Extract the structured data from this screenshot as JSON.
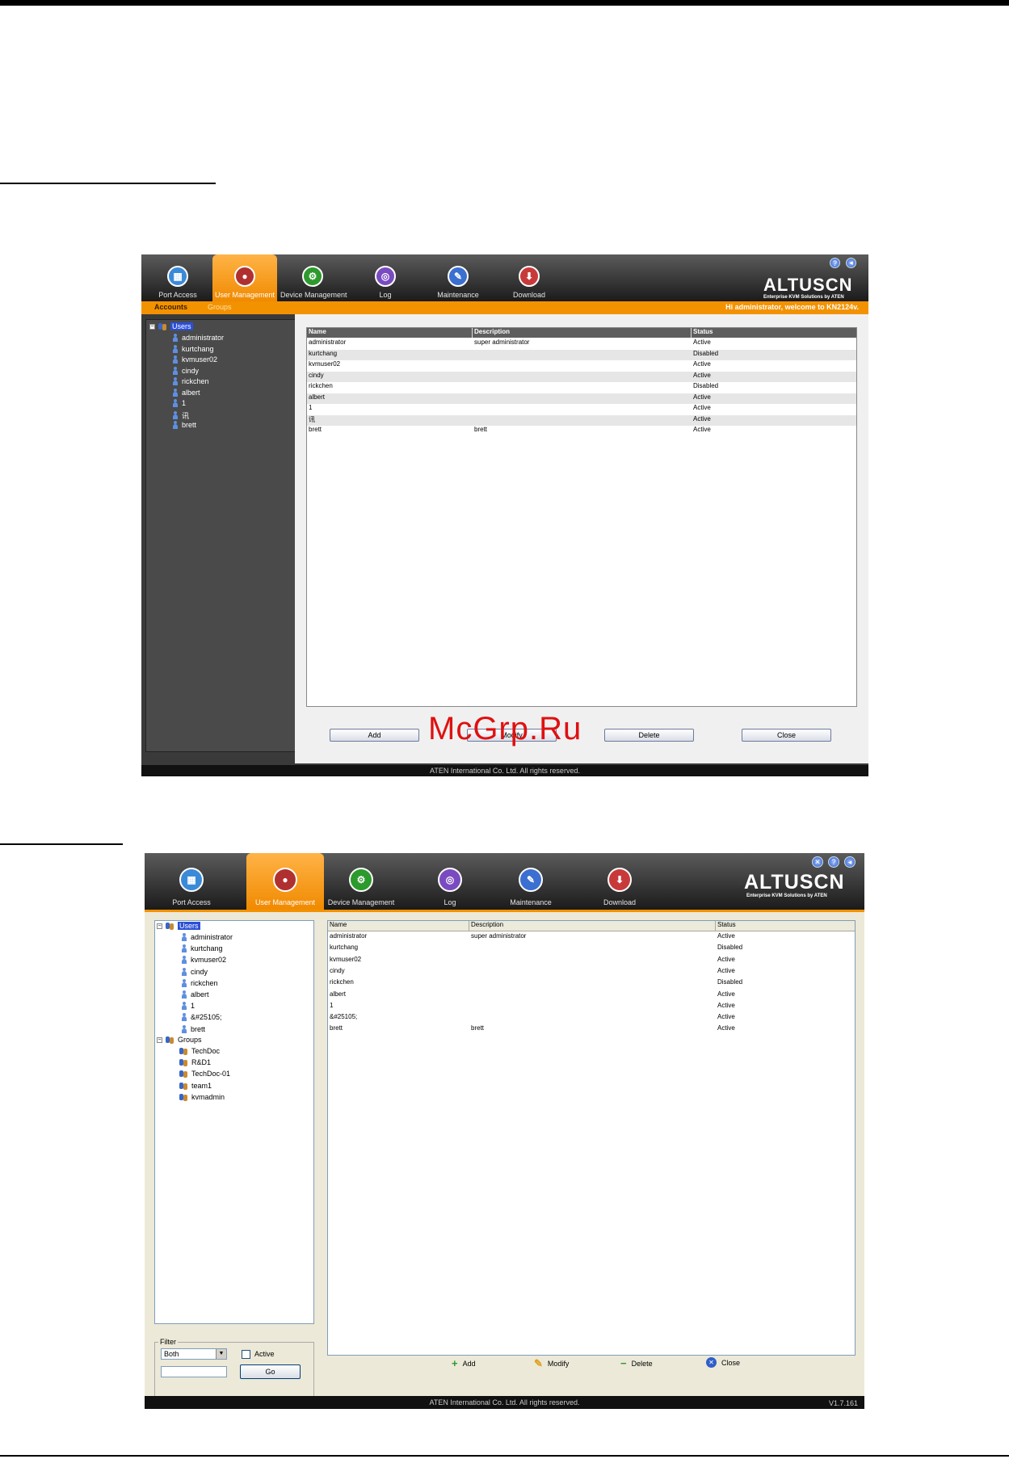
{
  "window_a": {
    "tabs": [
      {
        "label": "Port Access",
        "glyph": "▦"
      },
      {
        "label": "User Management",
        "glyph": "●"
      },
      {
        "label": "Device Management",
        "glyph": "⚙"
      },
      {
        "label": "Log",
        "glyph": "◎"
      },
      {
        "label": "Maintenance",
        "glyph": "✎"
      },
      {
        "label": "Download",
        "glyph": "⬇"
      }
    ],
    "logo": "ALTUSCN",
    "tagline": "Enterprise KVM Solutions by ATEN",
    "subtabs": [
      "Accounts",
      "Groups"
    ],
    "welcome": "Hi administrator, welcome to KN2124v.",
    "tree_root": "Users",
    "users": [
      "administrator",
      "kurtchang",
      "kvmuser02",
      "cindy",
      "rickchen",
      "albert",
      "1",
      "讯",
      "brett"
    ],
    "columns": [
      "Name",
      "Description",
      "Status"
    ],
    "rows": [
      [
        "administrator",
        "super administrator",
        "Active"
      ],
      [
        "kurtchang",
        "",
        "Disabled"
      ],
      [
        "kvmuser02",
        "",
        "Active"
      ],
      [
        "cindy",
        "",
        "Active"
      ],
      [
        "rickchen",
        "",
        "Disabled"
      ],
      [
        "albert",
        "",
        "Active"
      ],
      [
        "1",
        "",
        "Active"
      ],
      [
        "讯",
        "",
        "Active"
      ],
      [
        "brett",
        "brett",
        "Active"
      ]
    ],
    "buttons": {
      "add": "Add",
      "modify": "Modify",
      "delete": "Delete",
      "close": "Close"
    },
    "footer": "ATEN International Co. Ltd. All rights reserved."
  },
  "window_b": {
    "tabs": [
      {
        "label": "Port Access",
        "glyph": "▦"
      },
      {
        "label": "User Management",
        "glyph": "●"
      },
      {
        "label": "Device Management",
        "glyph": "⚙"
      },
      {
        "label": "Log",
        "glyph": "◎"
      },
      {
        "label": "Maintenance",
        "glyph": "✎"
      },
      {
        "label": "Download",
        "glyph": "⬇"
      }
    ],
    "logo": "ALTUSCN",
    "tagline": "Enterprise KVM Solutions by ATEN",
    "tree_root_users": "Users",
    "users": [
      "administrator",
      "kurtchang",
      "kvmuser02",
      "cindy",
      "rickchen",
      "albert",
      "1",
      "&#25105;",
      "brett"
    ],
    "tree_root_groups": "Groups",
    "groups": [
      "TechDoc",
      "R&D1",
      "TechDoc-01",
      "team1",
      "kvmadmin"
    ],
    "columns": [
      "Name",
      "Description",
      "Status"
    ],
    "rows": [
      [
        "administrator",
        "super administrator",
        "Active"
      ],
      [
        "kurtchang",
        "",
        "Disabled"
      ],
      [
        "kvmuser02",
        "",
        "Active"
      ],
      [
        "cindy",
        "",
        "Active"
      ],
      [
        "rickchen",
        "",
        "Disabled"
      ],
      [
        "albert",
        "",
        "Active"
      ],
      [
        "1",
        "",
        "Active"
      ],
      [
        "&#25105;",
        "",
        "Active"
      ],
      [
        "brett",
        "brett",
        "Active"
      ]
    ],
    "filter": {
      "legend": "Filter",
      "select_value": "Both",
      "checkbox_label": "Active",
      "go": "Go",
      "text_value": ""
    },
    "buttons": {
      "add": "Add",
      "modify": "Modify",
      "delete": "Delete",
      "close": "Close"
    },
    "footer": "ATEN International Co. Ltd. All rights reserved.",
    "version": "V1.7.161"
  },
  "watermark": "McGrp.Ru"
}
